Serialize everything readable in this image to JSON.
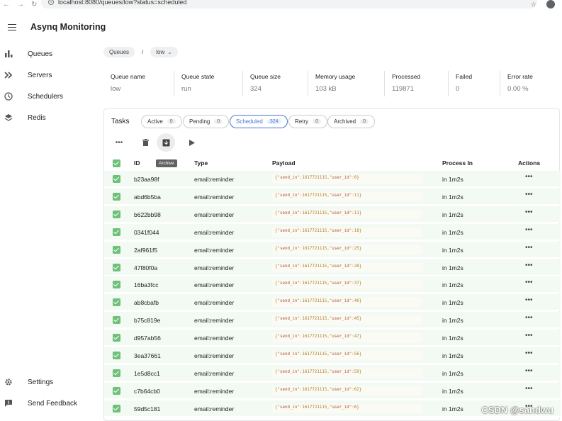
{
  "browser": {
    "url": "localhost:8080/queues/low?status=scheduled"
  },
  "app": {
    "title": "Asynq Monitoring"
  },
  "sidebar": {
    "items": [
      {
        "label": "Queues",
        "icon": "bar-chart-icon"
      },
      {
        "label": "Servers",
        "icon": "double-chevron-icon"
      },
      {
        "label": "Schedulers",
        "icon": "clock-icon"
      },
      {
        "label": "Redis",
        "icon": "layers-icon"
      }
    ],
    "bottom": [
      {
        "label": "Settings",
        "icon": "gear-icon"
      },
      {
        "label": "Send Feedback",
        "icon": "feedback-icon"
      }
    ]
  },
  "breadcrumb": {
    "root": "Queues",
    "separator": "/",
    "current": "low"
  },
  "stats": [
    {
      "label": "Queue name",
      "value": "low"
    },
    {
      "label": "Queue state",
      "value": "run"
    },
    {
      "label": "Queue size",
      "value": "324"
    },
    {
      "label": "Memory usage",
      "value": "103 kB"
    },
    {
      "label": "Processed",
      "value": "119871"
    },
    {
      "label": "Failed",
      "value": "0"
    },
    {
      "label": "Error rate",
      "value": "0.00 %"
    }
  ],
  "tasks": {
    "title": "Tasks",
    "tabs": [
      {
        "label": "Active",
        "count": "0"
      },
      {
        "label": "Pending",
        "count": "0"
      },
      {
        "label": "Scheduled",
        "count": "324"
      },
      {
        "label": "Retry",
        "count": "0"
      },
      {
        "label": "Archived",
        "count": "0"
      }
    ],
    "tooltip": "Archive",
    "columns": {
      "id": "ID",
      "type": "Type",
      "payload": "Payload",
      "process_in": "Process In",
      "actions": "Actions"
    },
    "rows": [
      {
        "id": "b23aa98f",
        "type": "email:reminder",
        "user_id": "0",
        "process_in": "in 1m2s"
      },
      {
        "id": "abd6b5ba",
        "type": "email:reminder",
        "user_id": "11",
        "process_in": "in 1m2s"
      },
      {
        "id": "b622bb98",
        "type": "email:reminder",
        "user_id": "11",
        "process_in": "in 1m2s"
      },
      {
        "id": "0341f044",
        "type": "email:reminder",
        "user_id": "18",
        "process_in": "in 1m2s"
      },
      {
        "id": "2af961f5",
        "type": "email:reminder",
        "user_id": "25",
        "process_in": "in 1m2s"
      },
      {
        "id": "47f80f0a",
        "type": "email:reminder",
        "user_id": "28",
        "process_in": "in 1m2s"
      },
      {
        "id": "16ba3fcc",
        "type": "email:reminder",
        "user_id": "37",
        "process_in": "in 1m2s"
      },
      {
        "id": "ab8cbafb",
        "type": "email:reminder",
        "user_id": "40",
        "process_in": "in 1m2s"
      },
      {
        "id": "b75c819e",
        "type": "email:reminder",
        "user_id": "45",
        "process_in": "in 1m2s"
      },
      {
        "id": "d957ab56",
        "type": "email:reminder",
        "user_id": "47",
        "process_in": "in 1m2s"
      },
      {
        "id": "3ea37661",
        "type": "email:reminder",
        "user_id": "56",
        "process_in": "in 1m2s"
      },
      {
        "id": "1e5d8cc1",
        "type": "email:reminder",
        "user_id": "59",
        "process_in": "in 1m2s"
      },
      {
        "id": "c7b64cb0",
        "type": "email:reminder",
        "user_id": "62",
        "process_in": "in 1m2s"
      },
      {
        "id": "59d5c181",
        "type": "email:reminder",
        "user_id": "6",
        "process_in": "in 1m2s"
      }
    ],
    "send_in": "1617721115"
  },
  "watermark": "CSDN @sandwu",
  "colors": {
    "accent": "#4a76d4",
    "checkbox": "#6ec07a",
    "row_bg": "#f3f9f3"
  }
}
